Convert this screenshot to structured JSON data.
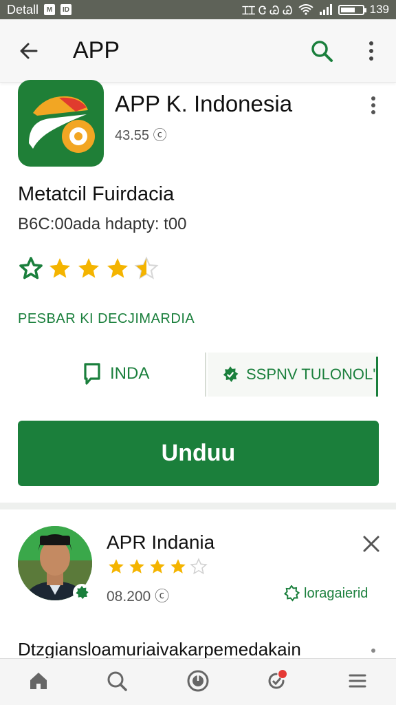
{
  "status_bar": {
    "carrier": "Detall",
    "icon_a": "M",
    "icon_b": "ID",
    "right_icons": "ꞮꞮ Ꮳ Ꮚ Ꮚ",
    "time": "139"
  },
  "app_bar": {
    "title": "APP",
    "back_icon": "arrow-back-icon",
    "search_icon": "search-icon",
    "menu_icon": "more-vert-icon",
    "accent": "#1a7f3c"
  },
  "app": {
    "name": "APP K. Indonesia",
    "meta": "43.55 ⓒ",
    "section_title": "Metatcil Fuirdacia",
    "section_sub": "B6C:00ada hdapty: t00",
    "rating": 4.5,
    "link_text": "PESBAR KI DECJIMARDIA",
    "action_left_label": "INDA",
    "action_right_label": "SSPNV TULONOL'",
    "install_label": "Unduu",
    "install_color": "#1b7f3b"
  },
  "card": {
    "name": "APR Indania",
    "rating": 4,
    "meta": "08.200 ⓒ",
    "link_text": "loragaierid",
    "close_icon": "close-icon"
  },
  "description": "Dtzgiansloamuriaivakarpemedakain",
  "bottom_nav": {
    "items": [
      "home-icon",
      "search-icon",
      "games-icon",
      "updates-icon",
      "menu-icon"
    ],
    "notification_color": "#e53935"
  }
}
